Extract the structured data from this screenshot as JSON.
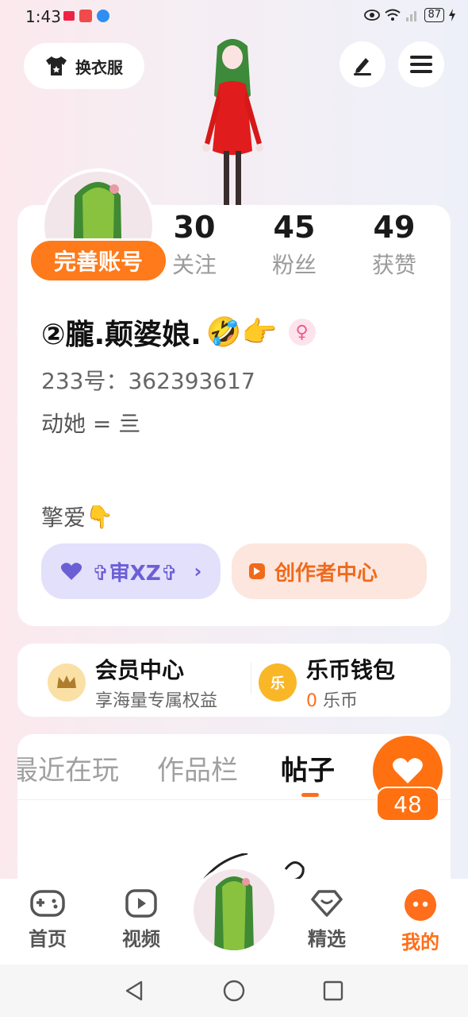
{
  "status_bar": {
    "time": "1:43",
    "battery": "87"
  },
  "header": {
    "outfit_label": "换衣服"
  },
  "profile": {
    "complete_label": "完善账号",
    "stats": [
      {
        "value": "30",
        "label": "关注"
      },
      {
        "value": "45",
        "label": "粉丝"
      },
      {
        "value": "49",
        "label": "获赞"
      }
    ],
    "nickname": "②朧.颠婆娘.",
    "nickname_emojis": "🤣👉",
    "gender_symbol": "♀",
    "uid": "233号：362393617",
    "bio_line1": "动她 = 亖",
    "bio_line2": "擎爱",
    "bio_emoji": "👇",
    "tag_label": "✞审XZ✞",
    "creator_label": "创作者中心"
  },
  "member": {
    "vip_title": "会员中心",
    "vip_subtitle": "享海量专属权益",
    "wallet_title": "乐币钱包",
    "wallet_amount": "0",
    "wallet_unit": "乐币",
    "wallet_icon_char": "乐"
  },
  "tabs": [
    {
      "label": "最近在玩"
    },
    {
      "label": "作品栏"
    },
    {
      "label": "帖子"
    }
  ],
  "like_count": "48",
  "nav": [
    {
      "label": "首页"
    },
    {
      "label": "视频"
    },
    {
      "label": "精选"
    },
    {
      "label": "我的"
    }
  ],
  "colors": {
    "accent": "#ff6e1a",
    "tag_purple": "#6b5fd6",
    "creator_orange": "#f06a1c"
  }
}
